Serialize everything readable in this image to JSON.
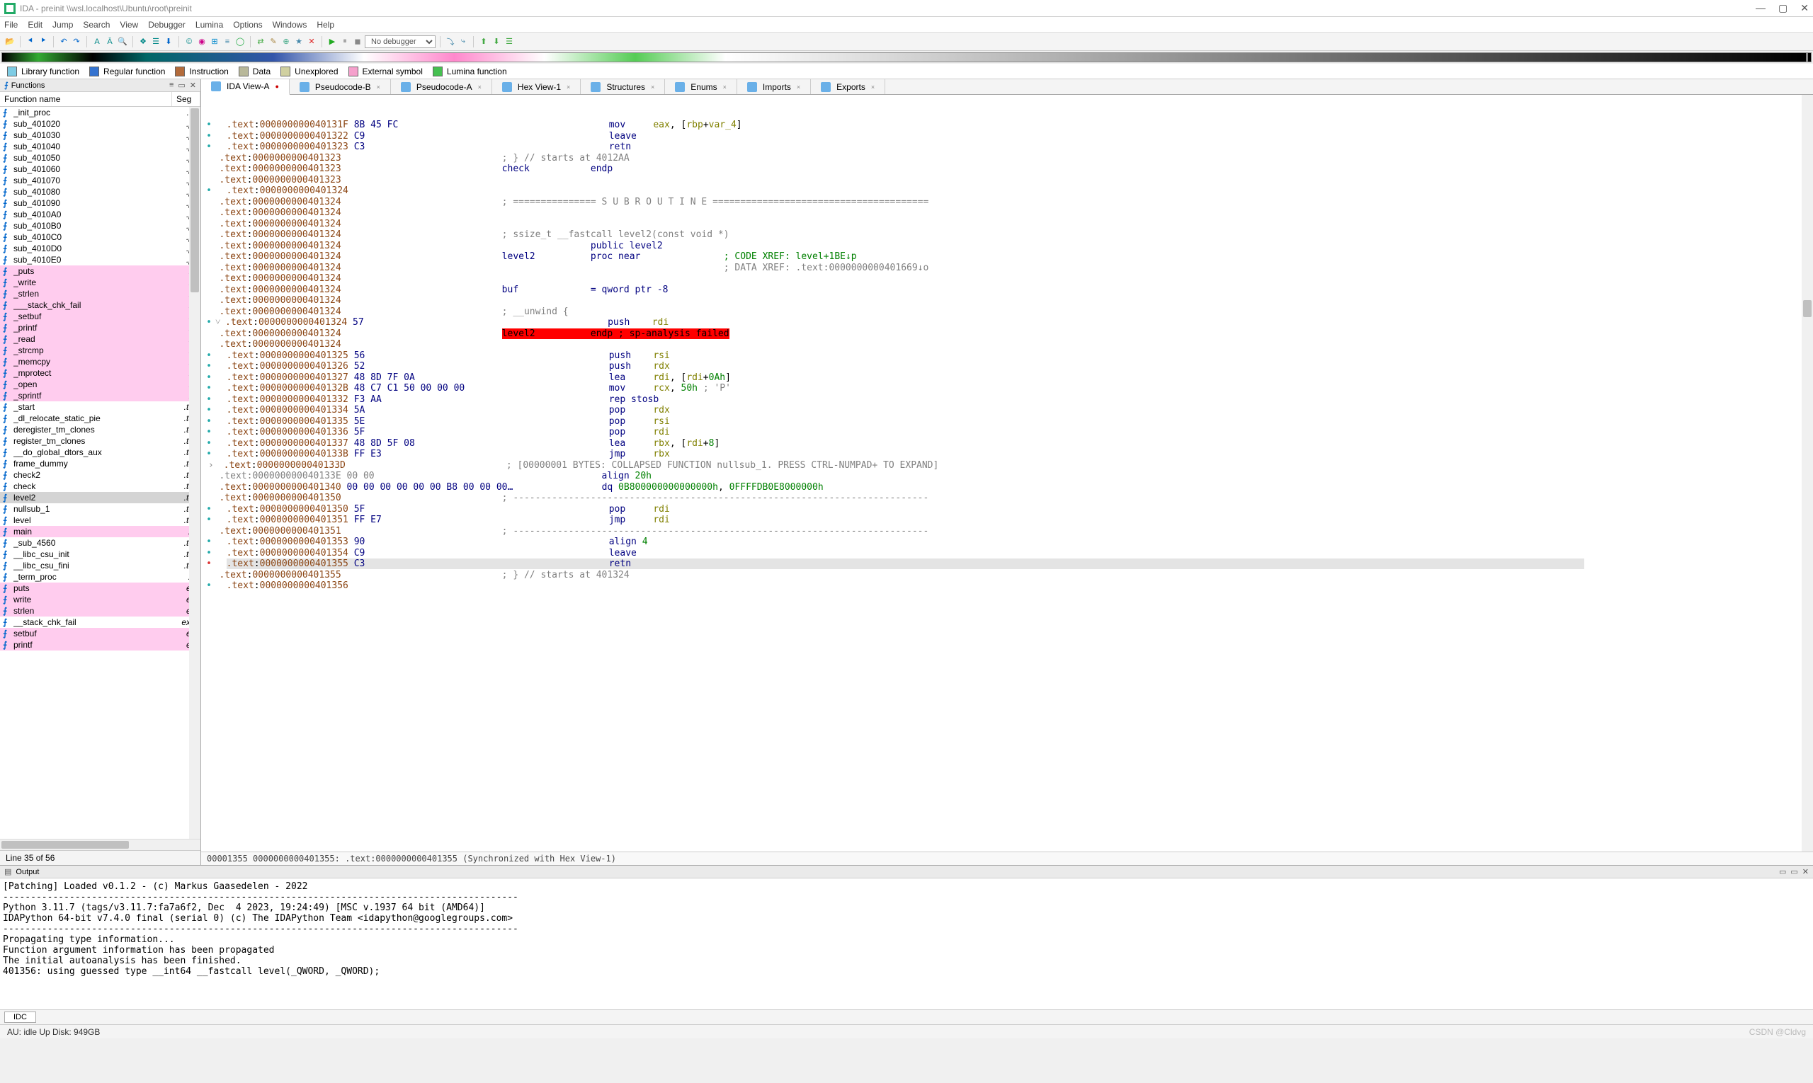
{
  "title": "IDA - preinit \\\\wsl.localhost\\Ubuntu\\root\\preinit",
  "menubar": [
    "File",
    "Edit",
    "Jump",
    "Search",
    "View",
    "Debugger",
    "Lumina",
    "Options",
    "Windows",
    "Help"
  ],
  "debugger_combo": "No debugger",
  "legend": [
    {
      "label": "Library function",
      "color": "#7ecce4"
    },
    {
      "label": "Regular function",
      "color": "#3573d0"
    },
    {
      "label": "Instruction",
      "color": "#b36b3b"
    },
    {
      "label": "Data",
      "color": "#b8b89a"
    },
    {
      "label": "Unexplored",
      "color": "#d0d0a0"
    },
    {
      "label": "External symbol",
      "color": "#f5a0cc"
    },
    {
      "label": "Lumina function",
      "color": "#45c050"
    }
  ],
  "functions_panel": {
    "title": "Functions",
    "col1": "Function name",
    "col2": "Seg",
    "rows": [
      {
        "n": "_init_proc",
        "s": ".ini",
        "hl": false
      },
      {
        "n": "sub_401020",
        "s": ".plt",
        "hl": false
      },
      {
        "n": "sub_401030",
        "s": ".plt",
        "hl": false
      },
      {
        "n": "sub_401040",
        "s": ".plt",
        "hl": false
      },
      {
        "n": "sub_401050",
        "s": ".plt",
        "hl": false
      },
      {
        "n": "sub_401060",
        "s": ".plt",
        "hl": false
      },
      {
        "n": "sub_401070",
        "s": ".plt",
        "hl": false
      },
      {
        "n": "sub_401080",
        "s": ".plt",
        "hl": false
      },
      {
        "n": "sub_401090",
        "s": ".plt",
        "hl": false
      },
      {
        "n": "sub_4010A0",
        "s": ".plt",
        "hl": false
      },
      {
        "n": "sub_4010B0",
        "s": ".plt",
        "hl": false
      },
      {
        "n": "sub_4010C0",
        "s": ".plt",
        "hl": false
      },
      {
        "n": "sub_4010D0",
        "s": ".plt",
        "hl": false
      },
      {
        "n": "sub_4010E0",
        "s": ".plt",
        "hl": false
      },
      {
        "n": "_puts",
        "s": ".pl",
        "hl": true
      },
      {
        "n": "_write",
        "s": ".pl",
        "hl": true
      },
      {
        "n": "_strlen",
        "s": ".pl",
        "hl": true
      },
      {
        "n": "___stack_chk_fail",
        "s": ".pl",
        "hl": true
      },
      {
        "n": "_setbuf",
        "s": ".pl",
        "hl": true
      },
      {
        "n": "_printf",
        "s": ".pl",
        "hl": true
      },
      {
        "n": "_read",
        "s": ".pl",
        "hl": true
      },
      {
        "n": "_strcmp",
        "s": ".pl",
        "hl": true
      },
      {
        "n": "_memcpy",
        "s": ".pl",
        "hl": true
      },
      {
        "n": "_mprotect",
        "s": ".pl",
        "hl": true
      },
      {
        "n": "_open",
        "s": ".pl",
        "hl": true
      },
      {
        "n": "_sprintf",
        "s": ".pl",
        "hl": true
      },
      {
        "n": "_start",
        "s": ".tex",
        "hl": false
      },
      {
        "n": "_dl_relocate_static_pie",
        "s": ".tex",
        "hl": false
      },
      {
        "n": "deregister_tm_clones",
        "s": ".tex",
        "hl": false
      },
      {
        "n": "register_tm_clones",
        "s": ".tex",
        "hl": false
      },
      {
        "n": "__do_global_dtors_aux",
        "s": ".tex",
        "hl": false
      },
      {
        "n": "frame_dummy",
        "s": ".tex",
        "hl": false
      },
      {
        "n": "check2",
        "s": ".tex",
        "hl": false
      },
      {
        "n": "check",
        "s": ".tex",
        "hl": false
      },
      {
        "n": "level2",
        "s": ".tex",
        "hl": false,
        "sel": true
      },
      {
        "n": "nullsub_1",
        "s": ".tex",
        "hl": false
      },
      {
        "n": "level",
        "s": ".tex",
        "hl": false
      },
      {
        "n": "main",
        "s": ".te",
        "hl": true
      },
      {
        "n": "_sub_4560",
        "s": ".tex",
        "hl": false
      },
      {
        "n": "__libc_csu_init",
        "s": ".tex",
        "hl": false
      },
      {
        "n": "__libc_csu_fini",
        "s": ".tex",
        "hl": false
      },
      {
        "n": "_term_proc",
        "s": ".fir",
        "hl": false
      },
      {
        "n": "puts",
        "s": "ext",
        "hl": true
      },
      {
        "n": "write",
        "s": "ext",
        "hl": true
      },
      {
        "n": "strlen",
        "s": "ext",
        "hl": true
      },
      {
        "n": "__stack_chk_fail",
        "s": "exte",
        "hl": false
      },
      {
        "n": "setbuf",
        "s": "ext",
        "hl": true
      },
      {
        "n": "printf",
        "s": "ext",
        "hl": true
      }
    ],
    "status": "Line 35 of 56"
  },
  "tabs": [
    {
      "label": "IDA View-A",
      "active": true,
      "closable": true
    },
    {
      "label": "Pseudocode-B"
    },
    {
      "label": "Pseudocode-A"
    },
    {
      "label": "Hex View-1"
    },
    {
      "label": "Structures"
    },
    {
      "label": "Enums"
    },
    {
      "label": "Imports"
    },
    {
      "label": "Exports"
    }
  ],
  "disasm_sync": "00001355 0000000000401355: .text:0000000000401355 (Synchronized with Hex View-1)",
  "output": {
    "title": "Output",
    "body": "[Patching] Loaded v0.1.2 - (c) Markus Gaasedelen - 2022\n---------------------------------------------------------------------------------------------\nPython 3.11.7 (tags/v3.11.7:fa7a6f2, Dec  4 2023, 19:24:49) [MSC v.1937 64 bit (AMD64)]\nIDAPython 64-bit v7.4.0 final (serial 0) (c) The IDAPython Team <idapython@googlegroups.com>\n---------------------------------------------------------------------------------------------\nPropagating type information...\nFunction argument information has been propagated\nThe initial autoanalysis has been finished.\n401356: using guessed type __int64 __fastcall level(_QWORD, _QWORD);",
    "tab": "IDC"
  },
  "statusbar": {
    "left": "AU:  idle   Up     Disk: 949GB",
    "right": "CSDN @Cldvg"
  }
}
